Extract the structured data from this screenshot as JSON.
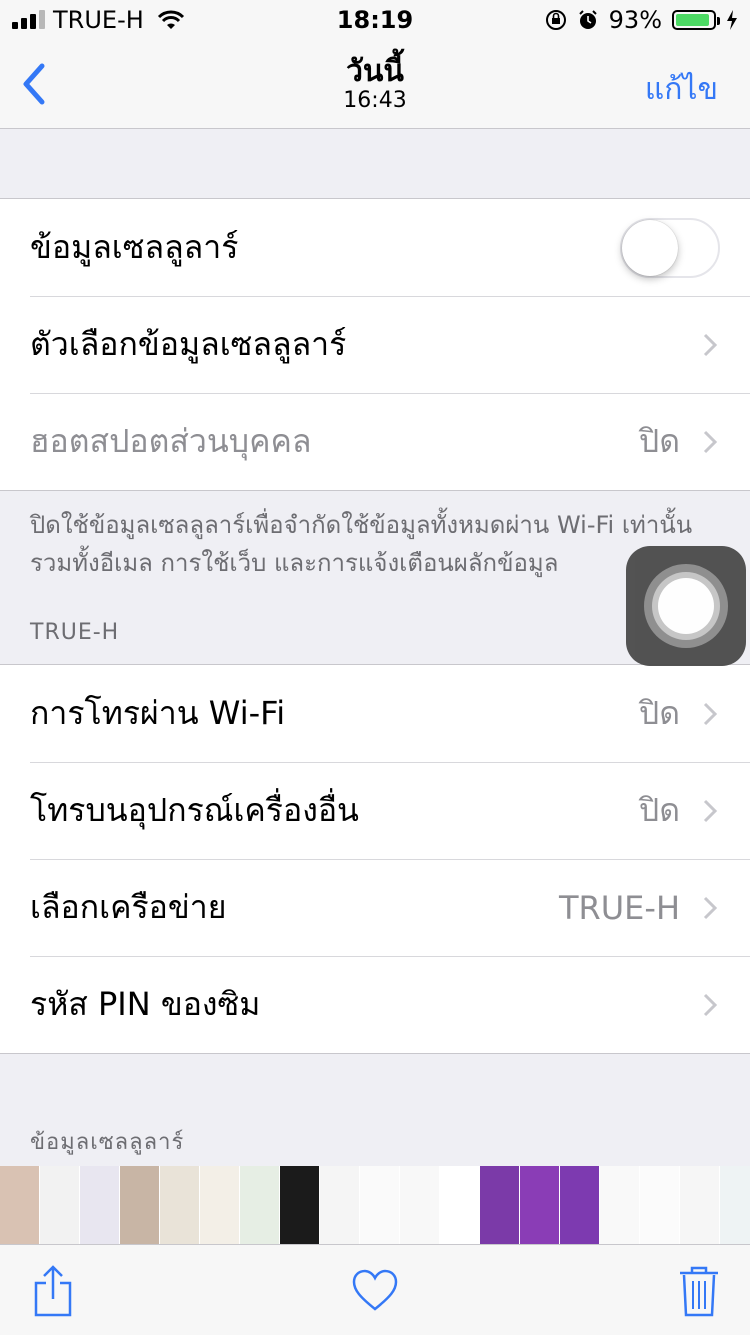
{
  "status_bar": {
    "carrier": "TRUE-H",
    "time": "18:19",
    "battery_percent": "93%",
    "battery_level": 0.93,
    "signal_bars": 3,
    "signal_bars_total": 4
  },
  "nav": {
    "title": "วันนี้",
    "subtitle": "16:43",
    "edit_label": "แก้ไข",
    "accent_color": "#3478f6"
  },
  "group1": {
    "cellular_data": {
      "label": "ข้อมูลเซลลูลาร์",
      "toggle_on": false
    },
    "cellular_options": {
      "label": "ตัวเลือกข้อมูลเซลลูลาร์"
    },
    "hotspot": {
      "label": "ฮอตสปอตส่วนบุคคล",
      "value": "ปิด"
    }
  },
  "footnote": {
    "line1": "ปิดใช้ข้อมูลเซลลูลาร์เพื่อจำกัดใช้ข้อมูลทั้งหมดผ่าน Wi-Fi เท่านั้น",
    "line2": "รวมทั้งอีเมล การใช้เว็บ และการแจ้งเตือนผลักข้อมูล"
  },
  "section_truh": {
    "header": "TRUE-H"
  },
  "group2": {
    "wifi_calling": {
      "label": "การโทรผ่าน Wi-Fi",
      "value": "ปิด"
    },
    "other_devices": {
      "label": "โทรบนอุปกรณ์เครื่องอื่น",
      "value": "ปิด"
    },
    "network_select": {
      "label": "เลือกเครือข่าย",
      "value": "TRUE-H"
    },
    "sim_pin": {
      "label": "รหัส PIN ของซิม"
    }
  },
  "section_cellular": {
    "header": "ข้อมูลเซลลูลาร์"
  },
  "thumbnails": [
    "#d9c2b3",
    "#f2f2f2",
    "#e8e6f0",
    "#c8b5a5",
    "#e9e3d8",
    "#f3efe7",
    "#e6eee4",
    "#1b1b1b",
    "#f5f5f5",
    "#fafafa",
    "#f8f8f8",
    "#ffffff",
    "#7b3aa8",
    "#8a3db6",
    "#7d3ab0",
    "#f9f9f9",
    "#fbfbfb",
    "#f6f6f6",
    "#eef3f4",
    "#fafafa",
    "#f4f7f7",
    "#f5f5f5",
    "#f7f1f1",
    "#f8f8f8"
  ],
  "toolbar": {
    "share_icon": "share-icon",
    "favorite_icon": "heart-icon",
    "delete_icon": "trash-icon"
  }
}
